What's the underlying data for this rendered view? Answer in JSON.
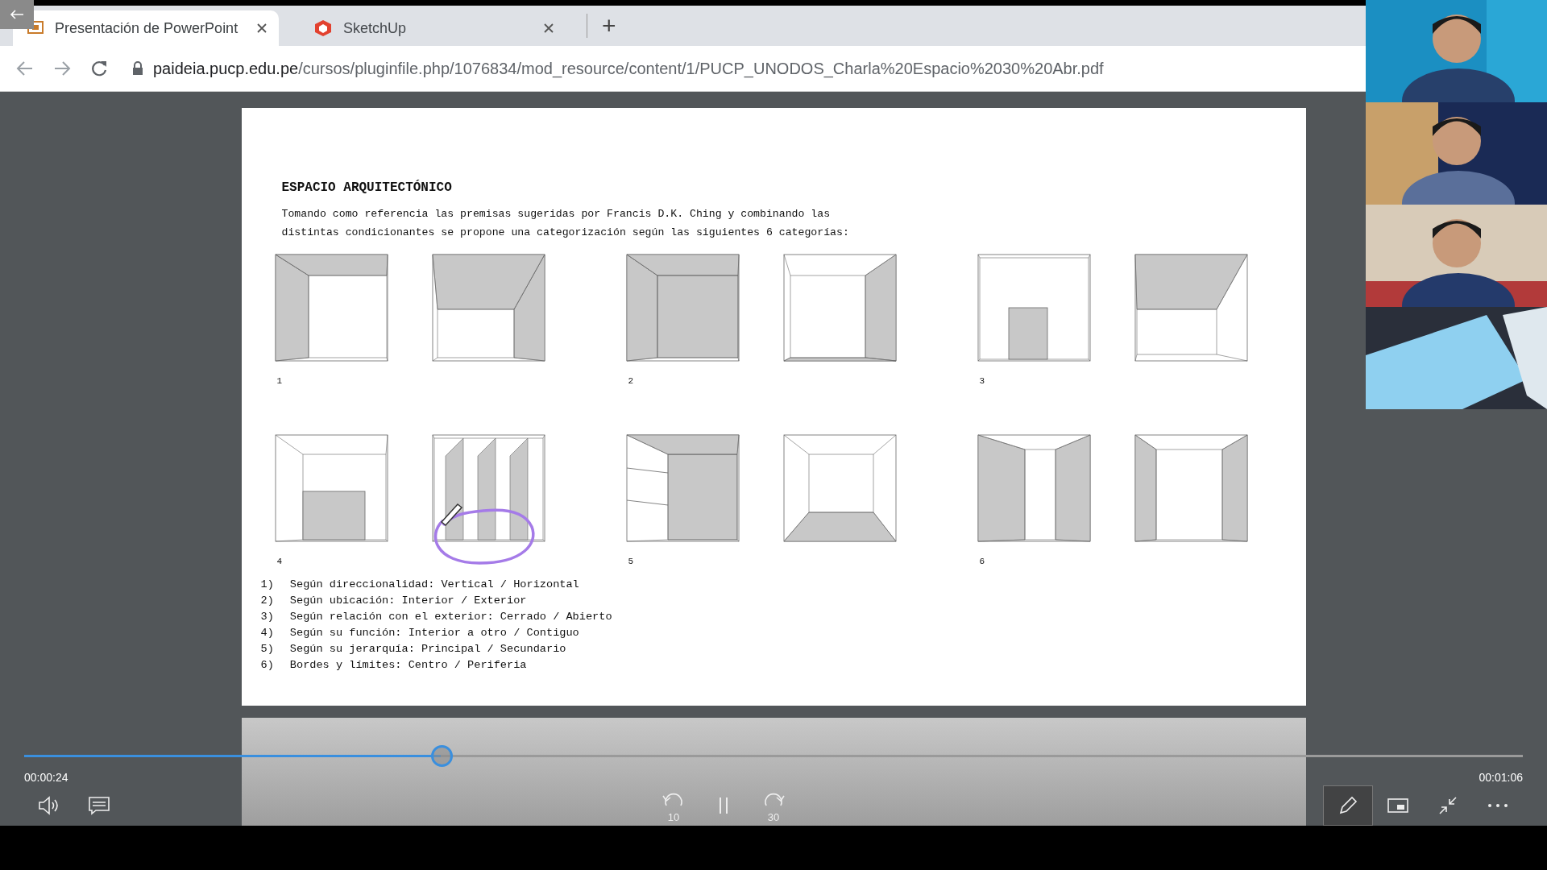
{
  "browser": {
    "tabs": [
      {
        "title": "Presentación de PowerPoint",
        "selected": true,
        "kind": "slides"
      },
      {
        "title": "SketchUp",
        "selected": false,
        "kind": "sketchup"
      }
    ],
    "new_tab": "+",
    "url_host": "paideia.pucp.edu.pe",
    "url_path": "/cursos/pluginfile.php/1076834/mod_resource/content/1/PUCP_UNODOS_Charla%20Espacio%2030%20Abr.pdf"
  },
  "document": {
    "heading": "ESPACIO ARQUITECTÓNICO",
    "intro_lines": [
      "Tomando como referencia las premisas sugeridas por Francis D.K. Ching y combinando las",
      "distintas condicionantes se propone una categorización según las siguientes 6 categorías:"
    ],
    "figures": [
      {
        "label": "1"
      },
      {
        "label": "2"
      },
      {
        "label": "3"
      },
      {
        "label": "4"
      },
      {
        "label": "5"
      },
      {
        "label": "6"
      }
    ],
    "criteria": [
      {
        "number": "1)",
        "text": "Según direccionalidad: Vertical / Horizontal"
      },
      {
        "number": "2)",
        "text": "Según ubicación: Interior / Exterior"
      },
      {
        "number": "3)",
        "text": "Según relación con el exterior: Cerrado / Abierto"
      },
      {
        "number": "4)",
        "text": "Según su función: Interior a otro / Contiguo"
      },
      {
        "number": "5)",
        "text": "Según su jerarquía: Principal / Secundario"
      },
      {
        "number": "6)",
        "text": "Bordes y límites: Centro / Periferia"
      }
    ]
  },
  "player": {
    "progress": {
      "level": 0.278
    },
    "elapsed": "00:00:24",
    "duration": "00:01:06",
    "skip_back": "10",
    "skip_forward": "30",
    "pen_active": true
  }
}
